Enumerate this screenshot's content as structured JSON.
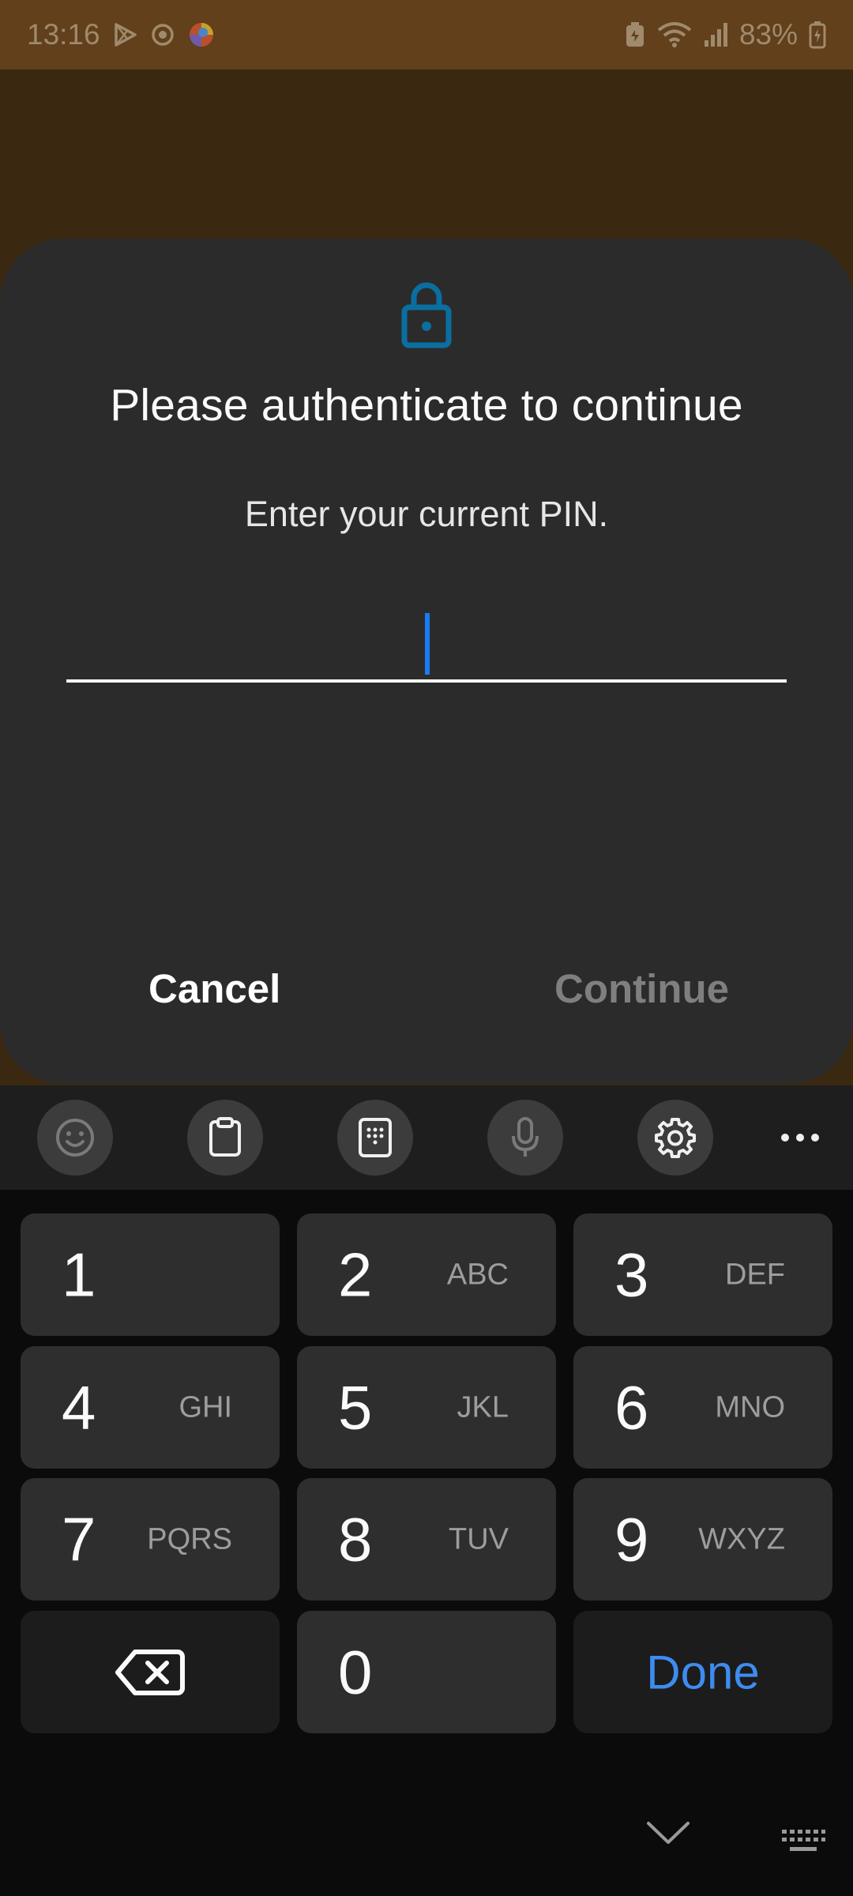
{
  "status_bar": {
    "time": "13:16",
    "battery": "83%",
    "icons": [
      "play-store-icon",
      "sync-icon",
      "app-icon",
      "battery-saver-icon",
      "wifi-icon",
      "signal-icon",
      "battery-charging-icon"
    ]
  },
  "dialog": {
    "icon": "lock-icon",
    "title": "Please authenticate to continue",
    "subtitle": "Enter your current PIN.",
    "pin_value": "",
    "cancel_label": "Cancel",
    "continue_label": "Continue",
    "accent_color": "#0a6fa0"
  },
  "keyboard": {
    "toolbar": [
      "emoji-icon",
      "clipboard-icon",
      "keypad-icon",
      "microphone-icon",
      "settings-icon",
      "more-icon"
    ],
    "keys": [
      {
        "digit": "1",
        "letters": ""
      },
      {
        "digit": "2",
        "letters": "ABC"
      },
      {
        "digit": "3",
        "letters": "DEF"
      },
      {
        "digit": "4",
        "letters": "GHI"
      },
      {
        "digit": "5",
        "letters": "JKL"
      },
      {
        "digit": "6",
        "letters": "MNO"
      },
      {
        "digit": "7",
        "letters": "PQRS"
      },
      {
        "digit": "8",
        "letters": "TUV"
      },
      {
        "digit": "9",
        "letters": "WXYZ"
      },
      {
        "digit": "0",
        "letters": ""
      }
    ],
    "done_label": "Done",
    "done_color": "#3e8cf0"
  }
}
